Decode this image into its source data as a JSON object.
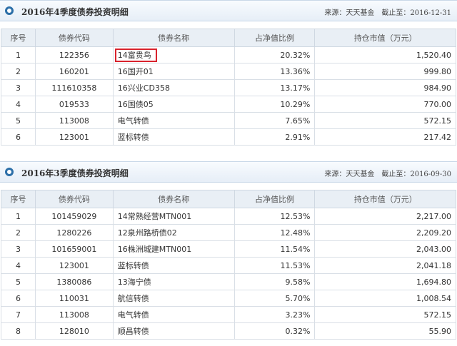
{
  "columns": [
    "序号",
    "债券代码",
    "债券名称",
    "占净值比例",
    "持仓市值（万元）"
  ],
  "sections": [
    {
      "title": "2016年4季度债券投资明细",
      "source_label": "来源：天天基金",
      "date_label": "截止至：2016-12-31",
      "rows": [
        {
          "no": "1",
          "code": "122356",
          "name": "14富贵鸟",
          "ratio": "20.32%",
          "value": "1,520.40"
        },
        {
          "no": "2",
          "code": "160201",
          "name": "16国开01",
          "ratio": "13.36%",
          "value": "999.80"
        },
        {
          "no": "3",
          "code": "111610358",
          "name": "16兴业CD358",
          "ratio": "13.17%",
          "value": "984.90"
        },
        {
          "no": "4",
          "code": "019533",
          "name": "16国债05",
          "ratio": "10.29%",
          "value": "770.00"
        },
        {
          "no": "5",
          "code": "113008",
          "name": "电气转债",
          "ratio": "7.65%",
          "value": "572.15"
        },
        {
          "no": "6",
          "code": "123001",
          "name": "蓝标转债",
          "ratio": "2.91%",
          "value": "217.42"
        }
      ]
    },
    {
      "title": "2016年3季度债券投资明细",
      "source_label": "来源：天天基金",
      "date_label": "截止至：2016-09-30",
      "rows": [
        {
          "no": "1",
          "code": "101459029",
          "name": "14常熟经营MTN001",
          "ratio": "12.53%",
          "value": "2,217.00"
        },
        {
          "no": "2",
          "code": "1280226",
          "name": "12泉州路桥债02",
          "ratio": "12.48%",
          "value": "2,209.20"
        },
        {
          "no": "3",
          "code": "101659001",
          "name": "16株洲城建MTN001",
          "ratio": "11.54%",
          "value": "2,043.00"
        },
        {
          "no": "4",
          "code": "123001",
          "name": "蓝标转债",
          "ratio": "11.53%",
          "value": "2,041.18"
        },
        {
          "no": "5",
          "code": "1380086",
          "name": "13海宁债",
          "ratio": "9.58%",
          "value": "1,694.80"
        },
        {
          "no": "6",
          "code": "110031",
          "name": "航信转债",
          "ratio": "5.70%",
          "value": "1,008.54"
        },
        {
          "no": "7",
          "code": "113008",
          "name": "电气转债",
          "ratio": "3.23%",
          "value": "572.15"
        },
        {
          "no": "8",
          "code": "128010",
          "name": "顺昌转债",
          "ratio": "0.32%",
          "value": "55.90"
        }
      ]
    }
  ]
}
